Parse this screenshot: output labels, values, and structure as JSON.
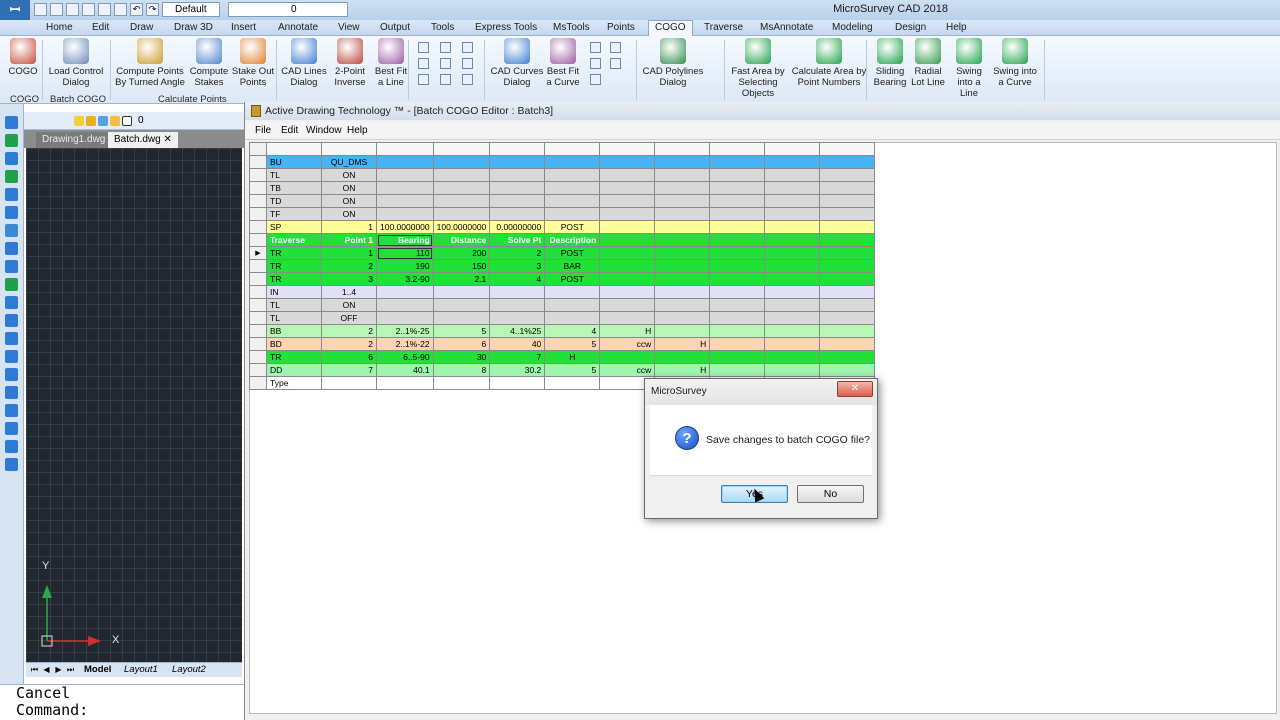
{
  "app": {
    "title": "MicroSurvey CAD 2018",
    "workspace": "Default",
    "layer": "0"
  },
  "tabs": [
    "Home",
    "Edit",
    "Draw",
    "Draw 3D",
    "Insert",
    "Annotate",
    "View",
    "Output",
    "Tools",
    "Express Tools",
    "MsTools",
    "Points",
    "COGO",
    "Traverse",
    "MsAnnotate",
    "Modeling",
    "Design",
    "Help"
  ],
  "active_tab": "COGO",
  "ribbon": {
    "buttons": [
      {
        "label1": "COGO",
        "label2": "",
        "icon": "pencil-icon"
      },
      {
        "label1": "Load Control",
        "label2": "Dialog",
        "icon": "gear-icon"
      },
      {
        "label1": "Compute Points",
        "label2": "By Turned Angle",
        "icon": "angle-icon"
      },
      {
        "label1": "Compute",
        "label2": "Stakes",
        "icon": "stakes-icon"
      },
      {
        "label1": "Stake Out",
        "label2": "Points",
        "icon": "stakeout-icon"
      },
      {
        "label1": "CAD Lines",
        "label2": "Dialog",
        "icon": "info-icon"
      },
      {
        "label1": "2-Point",
        "label2": "Inverse",
        "icon": "inverse-icon"
      },
      {
        "label1": "Best Fit",
        "label2": "a Line",
        "icon": "bestfit-line-icon"
      },
      {
        "label1": "CAD Curves",
        "label2": "Dialog",
        "icon": "info-icon"
      },
      {
        "label1": "Best Fit",
        "label2": "a Curve",
        "icon": "bestfit-curve-icon"
      },
      {
        "label1": "CAD Polylines",
        "label2": "Dialog",
        "icon": "polyline-icon"
      },
      {
        "label1": "Fast Area by",
        "label2": "Selecting Objects",
        "icon": "area-icon"
      },
      {
        "label1": "Calculate Area by",
        "label2": "Point Numbers",
        "icon": "area-points-icon"
      },
      {
        "label1": "Sliding",
        "label2": "Bearing",
        "icon": "sliding-icon"
      },
      {
        "label1": "Radial",
        "label2": "Lot Line",
        "icon": "radial-icon"
      },
      {
        "label1": "Swing",
        "label2": "into a Line",
        "icon": "swing-line-icon"
      },
      {
        "label1": "Swing into",
        "label2": "a Curve",
        "icon": "swing-curve-icon"
      }
    ],
    "panel_labels": [
      "COGO",
      "Batch COGO",
      "Calculate Points"
    ]
  },
  "left_panel": {
    "doc_tabs": [
      "Drawing1.dwg",
      "Batch.dwg"
    ],
    "layout_tabs": [
      "Model",
      "Layout1",
      "Layout2"
    ],
    "axis_x": "X",
    "axis_y": "Y"
  },
  "command_line": {
    "line1": "Cancel",
    "line2": "Command:"
  },
  "cogo_window": {
    "title": "Active Drawing Technology ™ - [Batch COGO Editor : Batch3]",
    "menu": [
      "File",
      "Edit",
      "Window",
      "Help"
    ]
  },
  "grid_rows": [
    {
      "style": "row-blue",
      "code": "BU",
      "cells": [
        "QU_DMS",
        "",
        "",
        "",
        "",
        "",
        "",
        "",
        "",
        ""
      ]
    },
    {
      "style": "row-gray",
      "code": "TL",
      "cells": [
        "ON",
        "",
        "",
        "",
        "",
        "",
        "",
        "",
        "",
        ""
      ]
    },
    {
      "style": "row-gray",
      "code": "TB",
      "cells": [
        "ON",
        "",
        "",
        "",
        "",
        "",
        "",
        "",
        "",
        ""
      ]
    },
    {
      "style": "row-gray",
      "code": "TD",
      "cells": [
        "ON",
        "",
        "",
        "",
        "",
        "",
        "",
        "",
        "",
        ""
      ]
    },
    {
      "style": "row-gray",
      "code": "TF",
      "cells": [
        "ON",
        "",
        "",
        "",
        "",
        "",
        "",
        "",
        "",
        ""
      ]
    },
    {
      "style": "row-yellow",
      "code": "SP",
      "cells": [
        "1",
        "100.0000000",
        "100.0000000",
        "0.00000000",
        "POST",
        "",
        "",
        "",
        "",
        ""
      ]
    },
    {
      "style": "row-green",
      "code": "Traverse",
      "header": true,
      "cells": [
        "Point 1",
        "Bearing",
        "Distance",
        "Solve Pt",
        "Description",
        "",
        "",
        "",
        "",
        ""
      ]
    },
    {
      "style": "row-green",
      "code": "TR",
      "current": true,
      "cells": [
        "1",
        "110",
        "200",
        "2",
        "POST",
        "",
        "",
        "",
        "",
        ""
      ]
    },
    {
      "style": "row-green",
      "code": "TR",
      "cells": [
        "2",
        "190",
        "150",
        "3",
        "BAR",
        "",
        "",
        "",
        "",
        ""
      ]
    },
    {
      "style": "row-green",
      "code": "TR",
      "cells": [
        "3",
        "3.2-90",
        "2.1",
        "4",
        "POST",
        "",
        "",
        "",
        "",
        ""
      ]
    },
    {
      "style": "row-lav",
      "code": "IN",
      "cells": [
        "1..4",
        "",
        "",
        "",
        "",
        "",
        "",
        "",
        "",
        ""
      ]
    },
    {
      "style": "row-gray",
      "code": "TL",
      "cells": [
        "ON",
        "",
        "",
        "",
        "",
        "",
        "",
        "",
        "",
        ""
      ]
    },
    {
      "style": "row-gray",
      "code": "TL",
      "cells": [
        "OFF",
        "",
        "",
        "",
        "",
        "",
        "",
        "",
        "",
        ""
      ]
    },
    {
      "style": "row-lgreen",
      "code": "BB",
      "cells": [
        "2",
        "2..1%-25",
        "5",
        "4..1%25",
        "4",
        "H",
        "",
        "",
        "",
        ""
      ]
    },
    {
      "style": "row-peach",
      "code": "BD",
      "cells": [
        "2",
        "2..1%-22",
        "6",
        "40",
        "5",
        "ccw",
        "H",
        "",
        "",
        ""
      ]
    },
    {
      "style": "row-green",
      "code": "TR",
      "cells": [
        "6",
        "6..5-90",
        "30",
        "7",
        "H",
        "",
        "",
        "",
        "",
        ""
      ]
    },
    {
      "style": "row-mint",
      "code": "DD",
      "cells": [
        "7",
        "40.1",
        "8",
        "30.2",
        "5",
        "ccw",
        "H",
        "",
        "",
        ""
      ]
    },
    {
      "style": "row-white",
      "code": "Type",
      "cells": [
        "",
        "",
        "",
        "",
        "",
        "",
        "",
        "",
        "",
        ""
      ]
    }
  ],
  "dialog": {
    "title": "MicroSurvey",
    "close_label": "✕",
    "message": "Save changes to batch COGO file?",
    "yes_label": "Yes",
    "no_label": "No"
  }
}
